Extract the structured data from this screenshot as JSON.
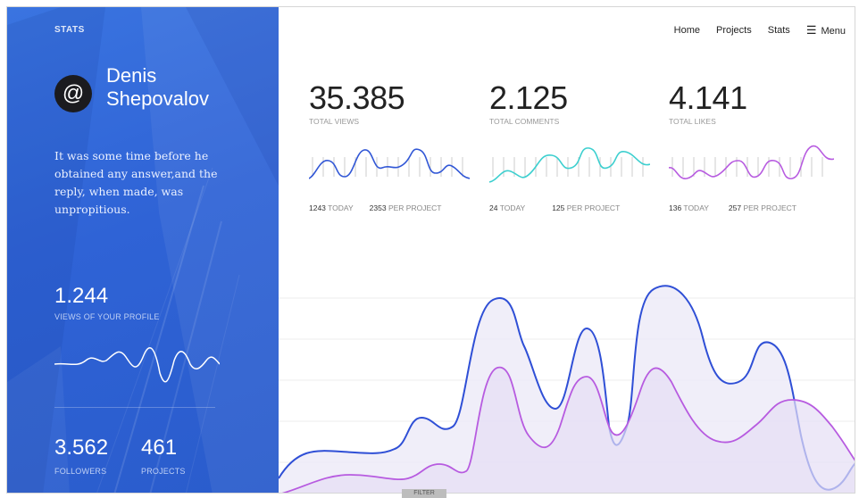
{
  "sidebar": {
    "section_label": "STATS",
    "avatar_symbol": "@",
    "user_name": "Denis Shepovalov",
    "quote": "It was some time before he obtained any answer,and the reply, when made, was unpropitious.",
    "profile_views": {
      "value": "1.244",
      "label": "VIEWS OF YOUR PROFILE"
    },
    "followers": {
      "value": "3.562",
      "label": "FOLLOWERS"
    },
    "projects": {
      "value": "461",
      "label": "PROJECTS"
    },
    "accent_bg": "#2f63d6"
  },
  "nav": {
    "items": [
      "Home",
      "Projects",
      "Stats"
    ],
    "menu_label": "Menu",
    "menu_icon": "hamburger-icon"
  },
  "stats": [
    {
      "value": "35.385",
      "label": "TOTAL VIEWS",
      "today": "1243",
      "today_label": "TODAY",
      "per_project": "2353",
      "per_project_label": "PER PROJECT",
      "color": "#3157d6"
    },
    {
      "value": "2.125",
      "label": "TOTAL COMMENTS",
      "today": "24",
      "today_label": "TODAY",
      "per_project": "125",
      "per_project_label": "PER PROJECT",
      "color": "#3ccfcf"
    },
    {
      "value": "4.141",
      "label": "TOTAL LIKES",
      "today": "136",
      "today_label": "TODAY",
      "per_project": "257",
      "per_project_label": "PER PROJECT",
      "color": "#b75be0"
    }
  ],
  "main_chart_colors": {
    "series_a": "#2f4fd6",
    "series_b": "#b75be0",
    "fill": "#eceaf7"
  },
  "bottom_tab_label": "FILTER"
}
